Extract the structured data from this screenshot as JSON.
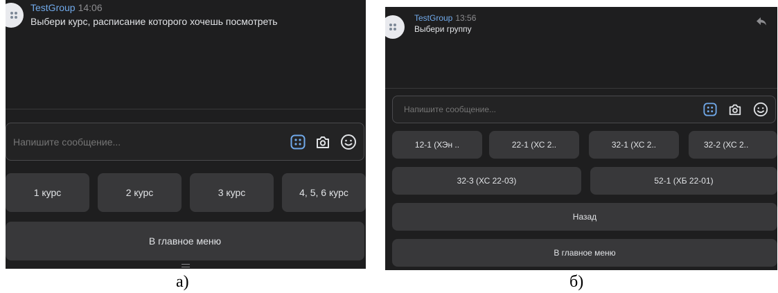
{
  "panel_a": {
    "message": {
      "sender": "TestGroup",
      "time": "14:06",
      "text": "Выбери курс, расписание которого хочешь посмотреть"
    },
    "composer": {
      "placeholder": "Напишите сообщение..."
    },
    "keyboard": {
      "row1": [
        "1 курс",
        "2 курс",
        "3 курс",
        "4, 5, 6 курс"
      ],
      "main_menu": "В главное меню"
    },
    "caption": "а)"
  },
  "panel_b": {
    "message": {
      "sender": "TestGroup",
      "time": "13:56",
      "text": "Выбери группу"
    },
    "composer": {
      "placeholder": "Напишите сообщение..."
    },
    "keyboard": {
      "row1": [
        "12-1 (ХЭн ..",
        "22-1 (ХС 2..",
        "32-1 (ХС 2..",
        "32-2 (ХС 2.."
      ],
      "row2": [
        "32-3 (ХС 22-03)",
        "52-1 (ХБ 22-01)"
      ],
      "back": "Назад",
      "main_menu": "В главное меню"
    },
    "caption": "б)"
  },
  "icons": [
    "group-avatar-icon",
    "bot-keyboard-icon",
    "camera-icon",
    "emoji-icon",
    "reply-icon",
    "drag-handle-icon"
  ],
  "colors": {
    "background": "#1e1e1f",
    "button": "#38383a",
    "accent": "#71aaeb",
    "text": "#e1e3e6"
  }
}
